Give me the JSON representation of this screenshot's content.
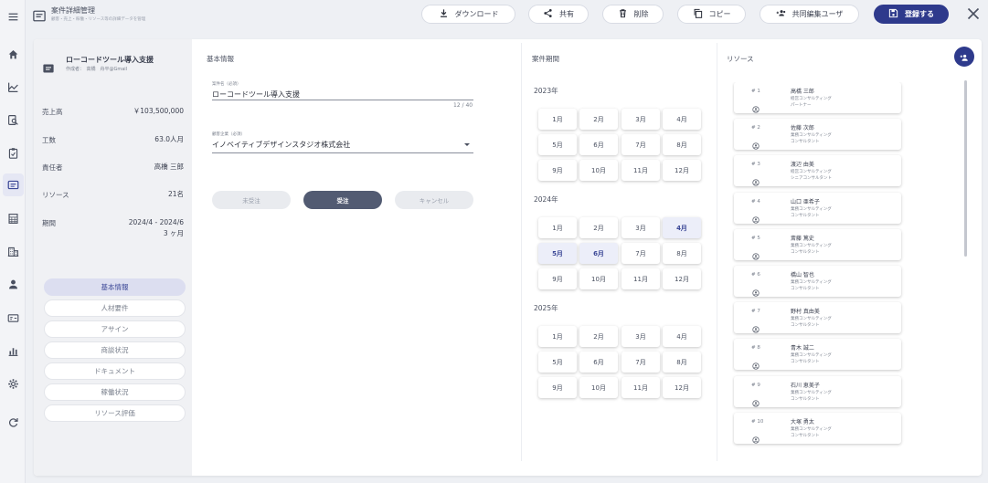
{
  "header": {
    "title": "案件詳細管理",
    "subtitle": "顧客・売上・稼働・リソース等の詳細データを管理",
    "buttons": {
      "download": "ダウンロード",
      "share": "共有",
      "delete": "削除",
      "copy": "コピー",
      "co_editors": "共同編集ユーザ",
      "register": "登録する"
    }
  },
  "project": {
    "title": "ローコードツール導入支援",
    "author": "作成者：　高橋　舟平@Gmail"
  },
  "stats": [
    {
      "label": "売上高",
      "value": "￥103,500,000"
    },
    {
      "label": "工数",
      "value": "63.0人月"
    },
    {
      "label": "責任者",
      "value": "高橋 三郎"
    },
    {
      "label": "リソース",
      "value": "21名"
    },
    {
      "label": "期間",
      "value": "2024/4 - 2024/6",
      "value2": "3 ヶ月"
    }
  ],
  "nav": [
    "基本情報",
    "人材要件",
    "アサイン",
    "商談状況",
    "ドキュメント",
    "稼働状況",
    "リソース評価"
  ],
  "nav_active": 0,
  "basic": {
    "section_title": "基本情報",
    "case_name_label": "案件名（必須）",
    "case_name": "ローコードツール導入支援",
    "case_name_counter": "12 / 40",
    "client_label": "顧客企業（必須）",
    "client": "イノベイティブデザインスタジオ株式会社",
    "status": [
      "未受注",
      "受注",
      "キャンセル"
    ],
    "status_active": 1
  },
  "period": {
    "section_title": "案件期間",
    "years": [
      {
        "year": "2023年",
        "months": [
          "1月",
          "2月",
          "3月",
          "4月",
          "5月",
          "6月",
          "7月",
          "8月",
          "9月",
          "10月",
          "11月",
          "12月"
        ],
        "selected": []
      },
      {
        "year": "2024年",
        "months": [
          "1月",
          "2月",
          "3月",
          "4月",
          "5月",
          "6月",
          "7月",
          "8月",
          "9月",
          "10月",
          "11月",
          "12月"
        ],
        "selected": [
          3,
          4,
          5
        ]
      },
      {
        "year": "2025年",
        "months": [
          "1月",
          "2月",
          "3月",
          "4月",
          "5月",
          "6月",
          "7月",
          "8月",
          "9月",
          "10月",
          "11月",
          "12月"
        ],
        "selected": []
      }
    ]
  },
  "resources": {
    "section_title": "リソース",
    "items": [
      {
        "no": "# 1",
        "name": "高橋 三郎",
        "dept": "経営コンサルティング",
        "role": "パートナー"
      },
      {
        "no": "# 2",
        "name": "佐藤 次郎",
        "dept": "業務コンサルティング",
        "role": "コンサルタント"
      },
      {
        "no": "# 3",
        "name": "渡辺 由美",
        "dept": "経営コンサルティング",
        "role": "シニアコンサルタント"
      },
      {
        "no": "# 4",
        "name": "山口 亜希子",
        "dept": "業務コンサルティング",
        "role": "コンサルタント"
      },
      {
        "no": "# 5",
        "name": "斎藤 篤史",
        "dept": "業務コンサルティング",
        "role": "コンサルタント"
      },
      {
        "no": "# 6",
        "name": "橋山 智也",
        "dept": "業務コンサルティング",
        "role": "コンサルタント"
      },
      {
        "no": "# 7",
        "name": "野村 真由美",
        "dept": "業務コンサルティング",
        "role": "コンサルタント"
      },
      {
        "no": "# 8",
        "name": "青木 誠二",
        "dept": "業務コンサルティング",
        "role": "コンサルタント"
      },
      {
        "no": "# 9",
        "name": "石川 恵美子",
        "dept": "業務コンサルティング",
        "role": "コンサルタント"
      },
      {
        "no": "# 10",
        "name": "大塚 勇太",
        "dept": "業務コンサルティング",
        "role": "コンサルタント"
      }
    ]
  },
  "colors": {
    "primary": "#2e3a8c",
    "accent_bg": "#dcdef0",
    "status_active": "#525b72"
  },
  "icons": {
    "rail": [
      "menu-icon",
      "home-icon",
      "trending-icon",
      "search-document-icon",
      "clipboard-icon",
      "note-icon",
      "grid-calendar-icon",
      "building-icon",
      "person-icon",
      "id-card-icon",
      "bar-chart-icon",
      "gear-icon",
      "refresh-icon"
    ],
    "resource_avatar": "person-circle-icon",
    "resource_delete": "trash-icon",
    "add_resource": "person-add-icon"
  }
}
